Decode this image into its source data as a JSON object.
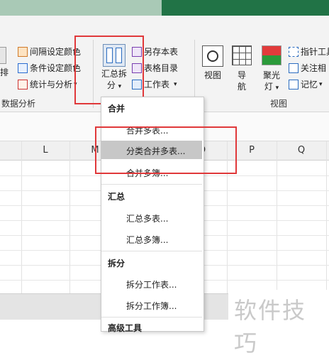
{
  "ribbon": {
    "group1": {
      "left_partial_label": "排",
      "items": [
        "间隔设定颜色",
        "条件设定颜色",
        "统计与分析"
      ],
      "stat_suffix": "▾",
      "group_label": "数据分析"
    },
    "summary_split": {
      "line1": "汇总拆",
      "line2": "分"
    },
    "small_right": {
      "items": [
        "另存本表",
        "表格目录",
        "工作表"
      ]
    },
    "view": {
      "buttons": [
        {
          "label": "视图"
        },
        {
          "label": "导航",
          "line2": "航"
        },
        {
          "label": "聚光灯"
        }
      ],
      "side_items": [
        "指针工具",
        "关注相",
        "记忆"
      ],
      "group_label": "视图"
    }
  },
  "sheet": {
    "columns": [
      "L",
      "M",
      "O",
      "P",
      "Q"
    ]
  },
  "menu": {
    "sections": [
      {
        "title": "合并",
        "items": [
          "合并多表...",
          "分类合并多表...",
          "合并多簿..."
        ]
      },
      {
        "title": "汇总",
        "items": [
          "汇总多表...",
          "汇总多簿..."
        ]
      },
      {
        "title": "拆分",
        "items": [
          "拆分工作表...",
          "拆分工作簿..."
        ]
      },
      {
        "title": "高级工具"
      }
    ]
  },
  "watermark": "软件技巧",
  "colors": {
    "excel_green": "#217346",
    "highlight_red": "#e0383a"
  }
}
